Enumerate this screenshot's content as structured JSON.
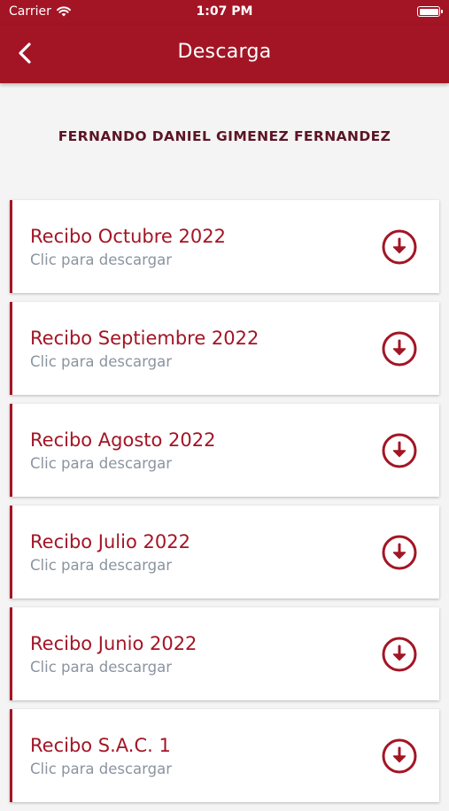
{
  "status_bar": {
    "carrier": "Carrier",
    "time": "1:07 PM"
  },
  "nav": {
    "title": "Descarga",
    "back_icon": "chevron-left-icon"
  },
  "user": {
    "name": "FERNANDO DANIEL GIMENEZ FERNANDEZ"
  },
  "receipts": [
    {
      "title": "Recibo Octubre 2022",
      "subtitle": "Clic para descargar"
    },
    {
      "title": "Recibo Septiembre 2022",
      "subtitle": "Clic para descargar"
    },
    {
      "title": "Recibo Agosto 2022",
      "subtitle": "Clic para descargar"
    },
    {
      "title": "Recibo Julio 2022",
      "subtitle": "Clic para descargar"
    },
    {
      "title": "Recibo Junio 2022",
      "subtitle": "Clic para descargar"
    },
    {
      "title": "Recibo S.A.C. 1",
      "subtitle": "Clic para descargar"
    }
  ],
  "colors": {
    "primary": "#a31525",
    "subtitle": "#8a94a0",
    "name": "#5c1526",
    "background": "#f4f4f4"
  }
}
